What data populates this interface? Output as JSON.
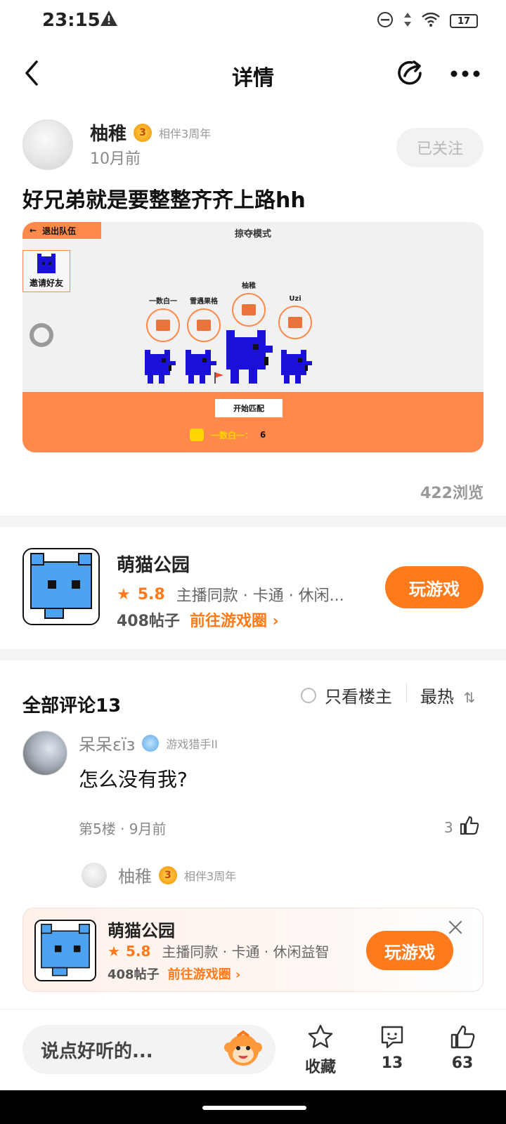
{
  "status_bar": {
    "time": "23:15",
    "battery": "17"
  },
  "header": {
    "title": "详情"
  },
  "post": {
    "author": "柚稚",
    "badge_text": "相伴3周年",
    "badge_medal": "3",
    "time": "10月前",
    "follow_label": "已关注",
    "title": "好兄弟就是要整整齐齐上路hh",
    "views": "422浏览",
    "screenshot": {
      "exit_label": "退出队伍",
      "mode": "掠夺模式",
      "invite_label": "邀请好友",
      "players": [
        "一数白一",
        "雪遇果格",
        "柚稚",
        "Uzi"
      ],
      "start_label": "开始匹配",
      "chat_name": "一数白一：",
      "chat_count": "6"
    }
  },
  "game": {
    "name": "萌猫公园",
    "rating": "5.8",
    "tags": "主播同款 · 卡通 · 休闲...",
    "tags_full": "主播同款 · 卡通 · 休闲益智",
    "posts": "408帖子",
    "goto_label": "前往游戏圈",
    "play_label": "玩游戏"
  },
  "comments": {
    "title": "全部评论13",
    "only_op_label": "只看楼主",
    "sort_label": "最热",
    "items": [
      {
        "name": "呆呆εïз",
        "badge_text": "游戏猎手II",
        "text": "怎么没有我?",
        "meta": "第5楼 · 9月前",
        "likes": "3"
      }
    ],
    "reply": {
      "name": "柚稚",
      "badge_text": "相伴3周年",
      "badge_medal": "3"
    }
  },
  "bottom_bar": {
    "input_placeholder": "说点好听的...",
    "favorite_label": "收藏",
    "comment_count": "13",
    "like_count": "63"
  },
  "colors": {
    "accent": "#ff7a1a",
    "shot_orange": "#ff8a4c",
    "cat_blue": "#1a10d8",
    "icon_blue": "#4da3f0"
  }
}
